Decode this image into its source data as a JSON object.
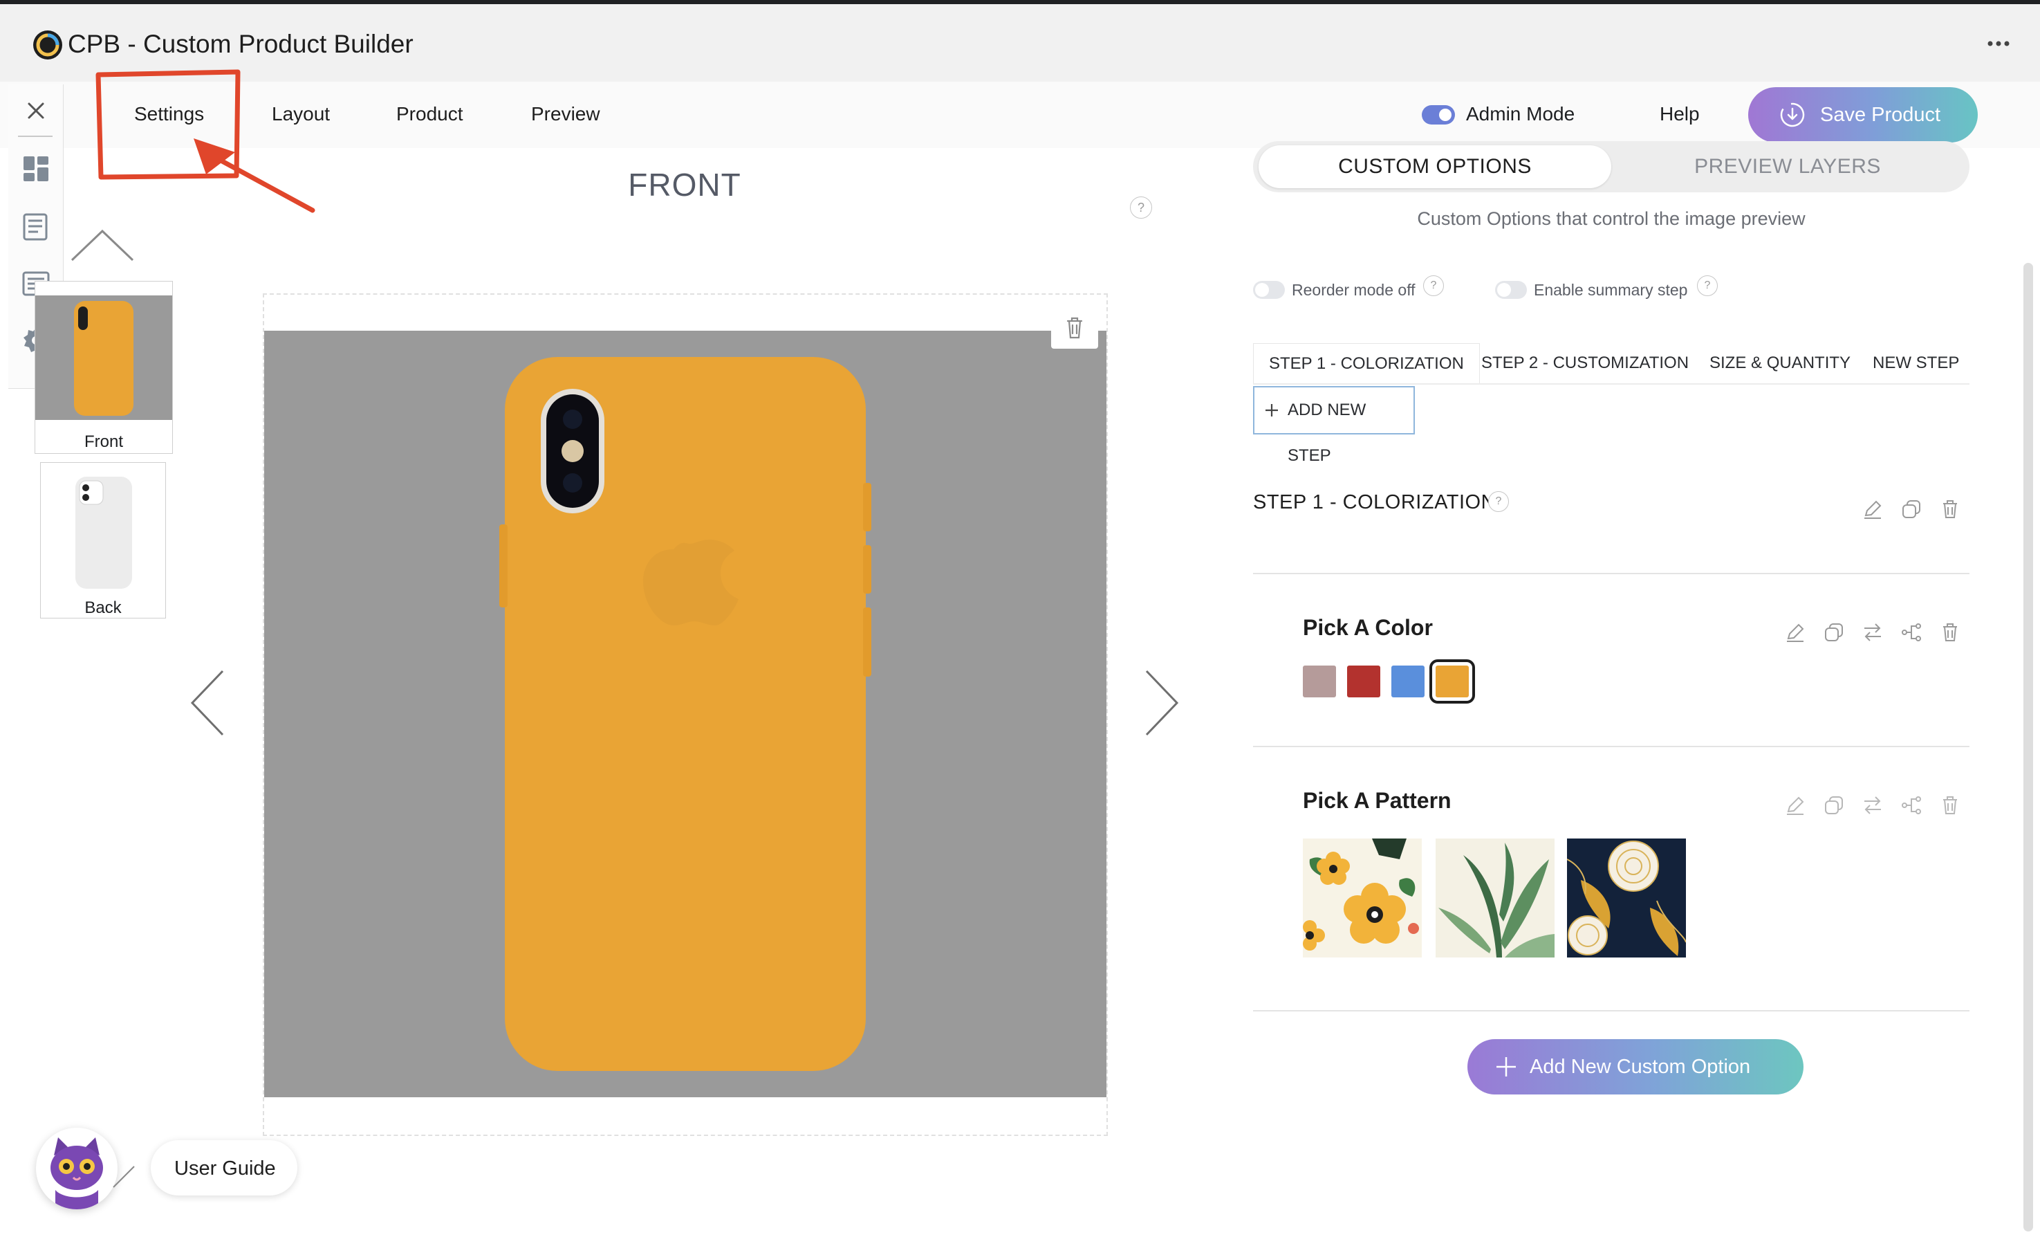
{
  "app": {
    "title": "CPB - Custom Product Builder"
  },
  "nav": {
    "items": [
      {
        "label": "Settings"
      },
      {
        "label": "Layout"
      },
      {
        "label": "Product"
      },
      {
        "label": "Preview"
      }
    ],
    "admin_mode_label": "Admin Mode",
    "admin_mode_on": true,
    "help_label": "Help",
    "save_label": "Save Product"
  },
  "views": [
    {
      "label": "Front"
    },
    {
      "label": "Back"
    }
  ],
  "canvas": {
    "title": "FRONT",
    "help": "?",
    "background_color": "#9a9a9a",
    "product_color": "#e9a435"
  },
  "panel": {
    "tabs": [
      {
        "label": "CUSTOM OPTIONS",
        "active": true
      },
      {
        "label": "PREVIEW LAYERS",
        "active": false
      }
    ],
    "subtitle": "Custom Options that control the image preview",
    "reorder_label": "Reorder mode off",
    "summary_label": "Enable summary step",
    "help": "?",
    "steps": [
      {
        "label": "STEP 1 - COLORIZATION",
        "active": true
      },
      {
        "label": "STEP 2 - CUSTOMIZATION",
        "active": false
      },
      {
        "label": "SIZE & QUANTITY",
        "active": false
      },
      {
        "label": "NEW STEP",
        "active": false
      }
    ],
    "add_step_label": "ADD NEW STEP",
    "section_title": "STEP 1 - COLORIZATION",
    "options": [
      {
        "title": "Pick A Color",
        "swatches": [
          "#b59b9a",
          "#b3322e",
          "#5a8fdc",
          "#e9a435"
        ],
        "selected_index": 3
      },
      {
        "title": "Pick A Pattern",
        "patterns": [
          "yellow-flower-pattern",
          "green-leaf-pattern",
          "dark-peony-pattern"
        ]
      }
    ],
    "add_option_label": "Add New Custom Option"
  },
  "guide": {
    "label": "User Guide"
  },
  "colors": {
    "accent_gradient_start": "#a077d4",
    "accent_gradient_end": "#68c4c4",
    "annotation_red": "#e0462b"
  }
}
